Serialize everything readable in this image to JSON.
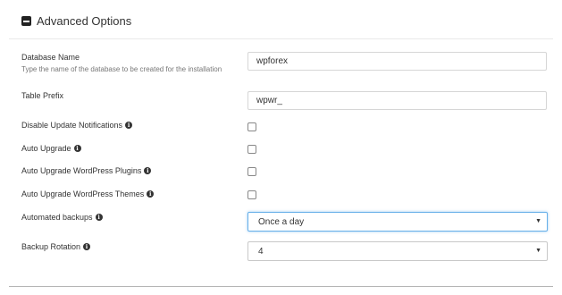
{
  "section": {
    "title": "Advanced Options",
    "icon": "minus-square-icon"
  },
  "fields": {
    "db_name": {
      "label": "Database Name",
      "help": "Type the name of the database to be created for the installation",
      "value": "wpforex"
    },
    "table_prefix": {
      "label": "Table Prefix",
      "value": "wpwr_"
    },
    "disable_updates": {
      "label": "Disable Update Notifications",
      "checked": false
    },
    "auto_upgrade": {
      "label": "Auto Upgrade",
      "checked": false
    },
    "auto_upgrade_plugins": {
      "label": "Auto Upgrade WordPress Plugins",
      "checked": false
    },
    "auto_upgrade_themes": {
      "label": "Auto Upgrade WordPress Themes",
      "checked": false
    },
    "automated_backups": {
      "label": "Automated backups",
      "value": "Once a day"
    },
    "backup_rotation": {
      "label": "Backup Rotation",
      "value": "4"
    }
  },
  "info_glyph": "i",
  "caret_glyph": "▼",
  "colors": {
    "focus": "#66afe9",
    "border": "#d6d6d6"
  }
}
